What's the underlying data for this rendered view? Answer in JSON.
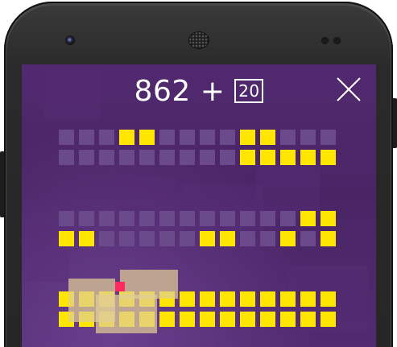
{
  "game": {
    "score": "862",
    "plus_sign": "+",
    "bonus": "20",
    "close_icon": "close-x-icon"
  },
  "colors": {
    "background": "#4e2a6c",
    "lit_cell": "#ffe600",
    "unlit_cell": "#6a4a8a",
    "accent_piece": "#ff2a5f"
  },
  "board": {
    "rows": [
      [
        0,
        0,
        0,
        1,
        1,
        0,
        0,
        0,
        0,
        1,
        1,
        0,
        0,
        0
      ],
      [
        0,
        0,
        0,
        0,
        0,
        0,
        0,
        0,
        0,
        1,
        1,
        1,
        1,
        1
      ],
      [
        0,
        0,
        0,
        0,
        0,
        0,
        0,
        0,
        0,
        0,
        0,
        0,
        1,
        1
      ],
      [
        1,
        1,
        0,
        0,
        0,
        0,
        0,
        1,
        1,
        0,
        0,
        1,
        0,
        1
      ],
      [
        1,
        1,
        1,
        1,
        1,
        1,
        1,
        1,
        1,
        1,
        1,
        1,
        1,
        1
      ],
      [
        1,
        1,
        1,
        1,
        1,
        1,
        1,
        1,
        1,
        1,
        1,
        1,
        1,
        1
      ]
    ]
  }
}
